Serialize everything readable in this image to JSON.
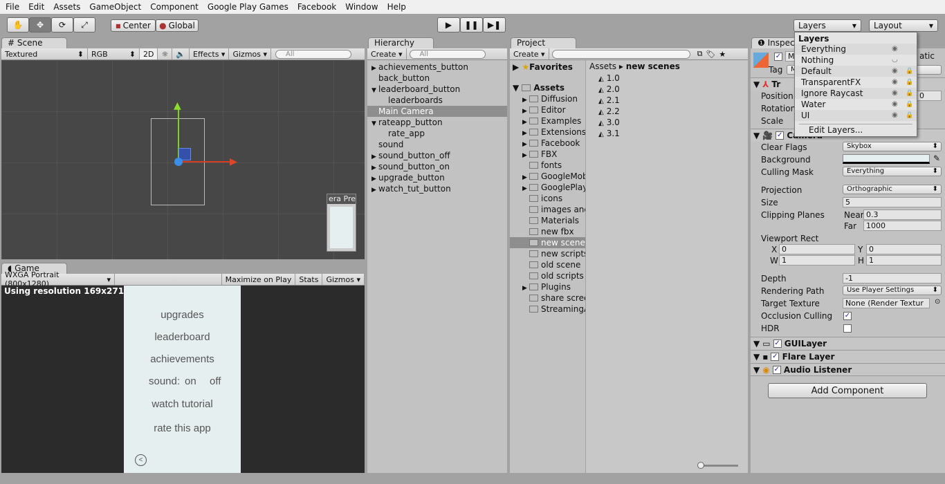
{
  "menu": [
    "File",
    "Edit",
    "Assets",
    "GameObject",
    "Component",
    "Google Play Games",
    "Facebook",
    "Window",
    "Help"
  ],
  "toolbar": {
    "tools": [
      "hand-icon",
      "move-icon",
      "rotate-icon",
      "scale-icon"
    ],
    "pivot": "Center",
    "space": "Global",
    "layers": "Layers",
    "layout": "Layout"
  },
  "scene": {
    "tab": "Scene",
    "render_mode": "Textured",
    "channel": "RGB",
    "mode_2d": "2D",
    "effects": "Effects",
    "gizmos": "Gizmos",
    "search": "All",
    "camera_preview": "era Pre"
  },
  "game": {
    "tab": "Game",
    "resolution": "WXGA Portrait (800x1280)",
    "maximize": "Maximize on Play",
    "stats": "Stats",
    "gizmos": "Gizmos",
    "status": "Using resolution 169x271",
    "menu_items": [
      "upgrades",
      "leaderboard",
      "achievements",
      "rate this app",
      "watch tutorial"
    ],
    "sound_label": "sound:",
    "sound_on": "on",
    "sound_off": "off"
  },
  "hierarchy": {
    "tab": "Hierarchy",
    "create": "Create",
    "search": "All",
    "items": [
      {
        "label": "achievements_button",
        "arrow": "▶",
        "indent": 0
      },
      {
        "label": "back_button",
        "arrow": "",
        "indent": 0
      },
      {
        "label": "leaderboard_button",
        "arrow": "▼",
        "indent": 0
      },
      {
        "label": "leaderboards",
        "arrow": "",
        "indent": 1
      },
      {
        "label": "Main Camera",
        "arrow": "",
        "indent": 0,
        "selected": true
      },
      {
        "label": "rateapp_button",
        "arrow": "▼",
        "indent": 0
      },
      {
        "label": "rate_app",
        "arrow": "",
        "indent": 1
      },
      {
        "label": "sound",
        "arrow": "",
        "indent": 0
      },
      {
        "label": "sound_button_off",
        "arrow": "▶",
        "indent": 0
      },
      {
        "label": "sound_button_on",
        "arrow": "▶",
        "indent": 0
      },
      {
        "label": "upgrade_button",
        "arrow": "▶",
        "indent": 0
      },
      {
        "label": "watch_tut_button",
        "arrow": "▶",
        "indent": 0
      }
    ]
  },
  "project": {
    "tab": "Project",
    "create": "Create",
    "favorites": "Favorites",
    "assets": "Assets",
    "breadcrumb": [
      "Assets",
      "new scenes"
    ],
    "folders": [
      {
        "label": "Diffusion",
        "arrow": "▶"
      },
      {
        "label": "Editor",
        "arrow": "▶"
      },
      {
        "label": "Examples",
        "arrow": "▶"
      },
      {
        "label": "Extensions",
        "arrow": "▶"
      },
      {
        "label": "Facebook",
        "arrow": "▶"
      },
      {
        "label": "FBX",
        "arrow": "▶"
      },
      {
        "label": "fonts",
        "arrow": ""
      },
      {
        "label": "GoogleMob",
        "arrow": "▶"
      },
      {
        "label": "GooglePlay",
        "arrow": "▶"
      },
      {
        "label": "icons",
        "arrow": ""
      },
      {
        "label": "images and",
        "arrow": ""
      },
      {
        "label": "Materials",
        "arrow": ""
      },
      {
        "label": "new fbx",
        "arrow": ""
      },
      {
        "label": "new scenes",
        "arrow": "",
        "selected": true
      },
      {
        "label": "new scripts",
        "arrow": ""
      },
      {
        "label": "old scene",
        "arrow": ""
      },
      {
        "label": "old scripts",
        "arrow": ""
      },
      {
        "label": "Plugins",
        "arrow": "▶"
      },
      {
        "label": "share scree",
        "arrow": ""
      },
      {
        "label": "StreamingA",
        "arrow": ""
      }
    ],
    "files": [
      "1.0",
      "2.0",
      "2.1",
      "2.2",
      "3.0",
      "3.1"
    ]
  },
  "inspector": {
    "tab": "Inspec",
    "static": "atic",
    "tag_label": "Tag",
    "tag_value": "M",
    "name_value": "M",
    "transform": "Tr",
    "position": "Position",
    "rotation": "Rotation",
    "scale": "Scale",
    "pos_z": "0",
    "camera": {
      "title": "Camera",
      "clear_flags_label": "Clear Flags",
      "clear_flags": "Skybox",
      "background_label": "Background",
      "background_color": "#e6eff0",
      "culling_mask_label": "Culling Mask",
      "culling_mask": "Everything",
      "projection_label": "Projection",
      "projection": "Orthographic",
      "size_label": "Size",
      "size": "5",
      "clipping_label": "Clipping Planes",
      "near_label": "Near",
      "near": "0.3",
      "far_label": "Far",
      "far": "1000",
      "viewport_label": "Viewport Rect",
      "x_label": "X",
      "x": "0",
      "y_label": "Y",
      "y": "0",
      "w_label": "W",
      "w": "1",
      "h_label": "H",
      "h": "1",
      "depth_label": "Depth",
      "depth": "-1",
      "rendering_path_label": "Rendering Path",
      "rendering_path": "Use Player Settings",
      "target_texture_label": "Target Texture",
      "target_texture": "None (Render Textur",
      "occlusion_label": "Occlusion Culling",
      "occlusion": true,
      "hdr_label": "HDR",
      "hdr": false
    },
    "components": [
      "GUILayer",
      "Flare Layer",
      "Audio Listener"
    ],
    "add_component": "Add Component"
  },
  "layers_dropdown": {
    "title": "Layers",
    "items": [
      {
        "label": "Everything",
        "eye": true,
        "lock": false
      },
      {
        "label": "Nothing",
        "eye": false,
        "lock": false
      },
      {
        "label": "Default",
        "eye": true,
        "lock": true
      },
      {
        "label": "TransparentFX",
        "eye": true,
        "lock": true
      },
      {
        "label": "Ignore Raycast",
        "eye": true,
        "lock": true
      },
      {
        "label": "Water",
        "eye": true,
        "lock": true
      },
      {
        "label": "UI",
        "eye": true,
        "lock": true
      }
    ],
    "edit": "Edit Layers..."
  }
}
